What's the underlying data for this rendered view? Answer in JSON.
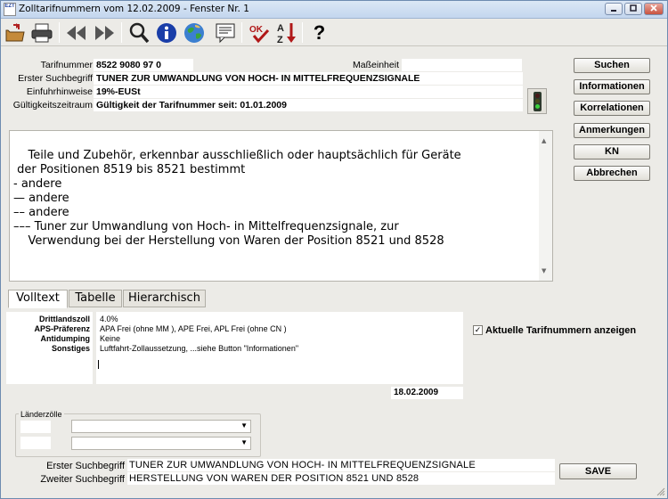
{
  "window": {
    "title": "Zolltarifnummern vom 12.02.2009 - Fenster Nr. 1",
    "app_icon_text": "EZT"
  },
  "toolbar": {
    "icons": [
      "open-folder-icon",
      "print-icon",
      "first-record-icon",
      "last-record-icon",
      "search-icon",
      "info-icon",
      "globe-icon",
      "notes-icon",
      "check-icon",
      "sort-az-icon",
      "help-icon"
    ],
    "help_glyph": "?"
  },
  "header": {
    "tarifnummer_label": "Tarifnummer",
    "tarifnummer_value": "8522 9080 97 0",
    "masseinheit_label": "Maßeinheit",
    "masseinheit_value": "",
    "erster_label": "Erster Suchbegriff",
    "erster_value": "TUNER ZUR UMWANDLUNG VON HOCH- IN MITTELFREQUENZSIGNALE",
    "einfuhr_label": "Einfuhrhinweise",
    "einfuhr_value": "19%-EUSt",
    "gueltig_label": "Gültigkeitszeitraum",
    "gueltig_value": "Gültigkeit der Tarifnummer seit: 01.01.2009"
  },
  "buttons": {
    "suchen": "Suchen",
    "informationen": "Informationen",
    "korrelationen": "Korrelationen",
    "anmerkungen": "Anmerkungen",
    "kn": "KN",
    "abbrechen": "Abbrechen",
    "save": "SAVE"
  },
  "description": "Teile und Zubehör, erkennbar ausschließlich oder hauptsächlich für Geräte\n der Positionen 8519 bis 8521 bestimmt\n- andere\n— andere\n–– andere\n––– Tuner zur Umwandlung von Hoch- in Mittelfrequenzsignale, zur\n    Verwendung bei der Herstellung von Waren der Position 8521 und 8528",
  "tabs": [
    {
      "label": "Volltext",
      "active": true
    },
    {
      "label": "Tabelle",
      "active": false
    },
    {
      "label": "Hierarchisch",
      "active": false
    }
  ],
  "details": {
    "drittlandszoll_label": "Drittlandszoll",
    "drittlandszoll_value": "4.0%",
    "aps_label": "APS-Präferenz",
    "aps_value": "APA Frei (ohne MM ), APE Frei, APL Frei (ohne CN )",
    "antidumping_label": "Antidumping",
    "antidumping_value": "Keine",
    "sonstiges_label": "Sonstiges",
    "sonstiges_value": "Luftfahrt-Zollaussetzung, ...siehe Button \"Informationen\""
  },
  "checkbox": {
    "label": "Aktuelle Tarifnummern anzeigen",
    "checked": true,
    "mark": "✓"
  },
  "date": "18.02.2009",
  "laenderzoelle": {
    "label": "Länderzölle",
    "combo1_value": "",
    "combo2_value": ""
  },
  "bottom": {
    "erster_label": "Erster Suchbegriff",
    "erster_value": "TUNER ZUR UMWANDLUNG VON HOCH- IN MITTELFREQUENZSIGNALE",
    "zweiter_label": "Zweiter Suchbegriff",
    "zweiter_value": "HERSTELLUNG VON WAREN DER POSITION 8521 UND 8528"
  },
  "colors": {
    "window_bg": "#ecebe7",
    "title_bar": "#c3d6ee",
    "traffic_green": "#3bd13b",
    "traffic_red": "#c22a2a"
  }
}
